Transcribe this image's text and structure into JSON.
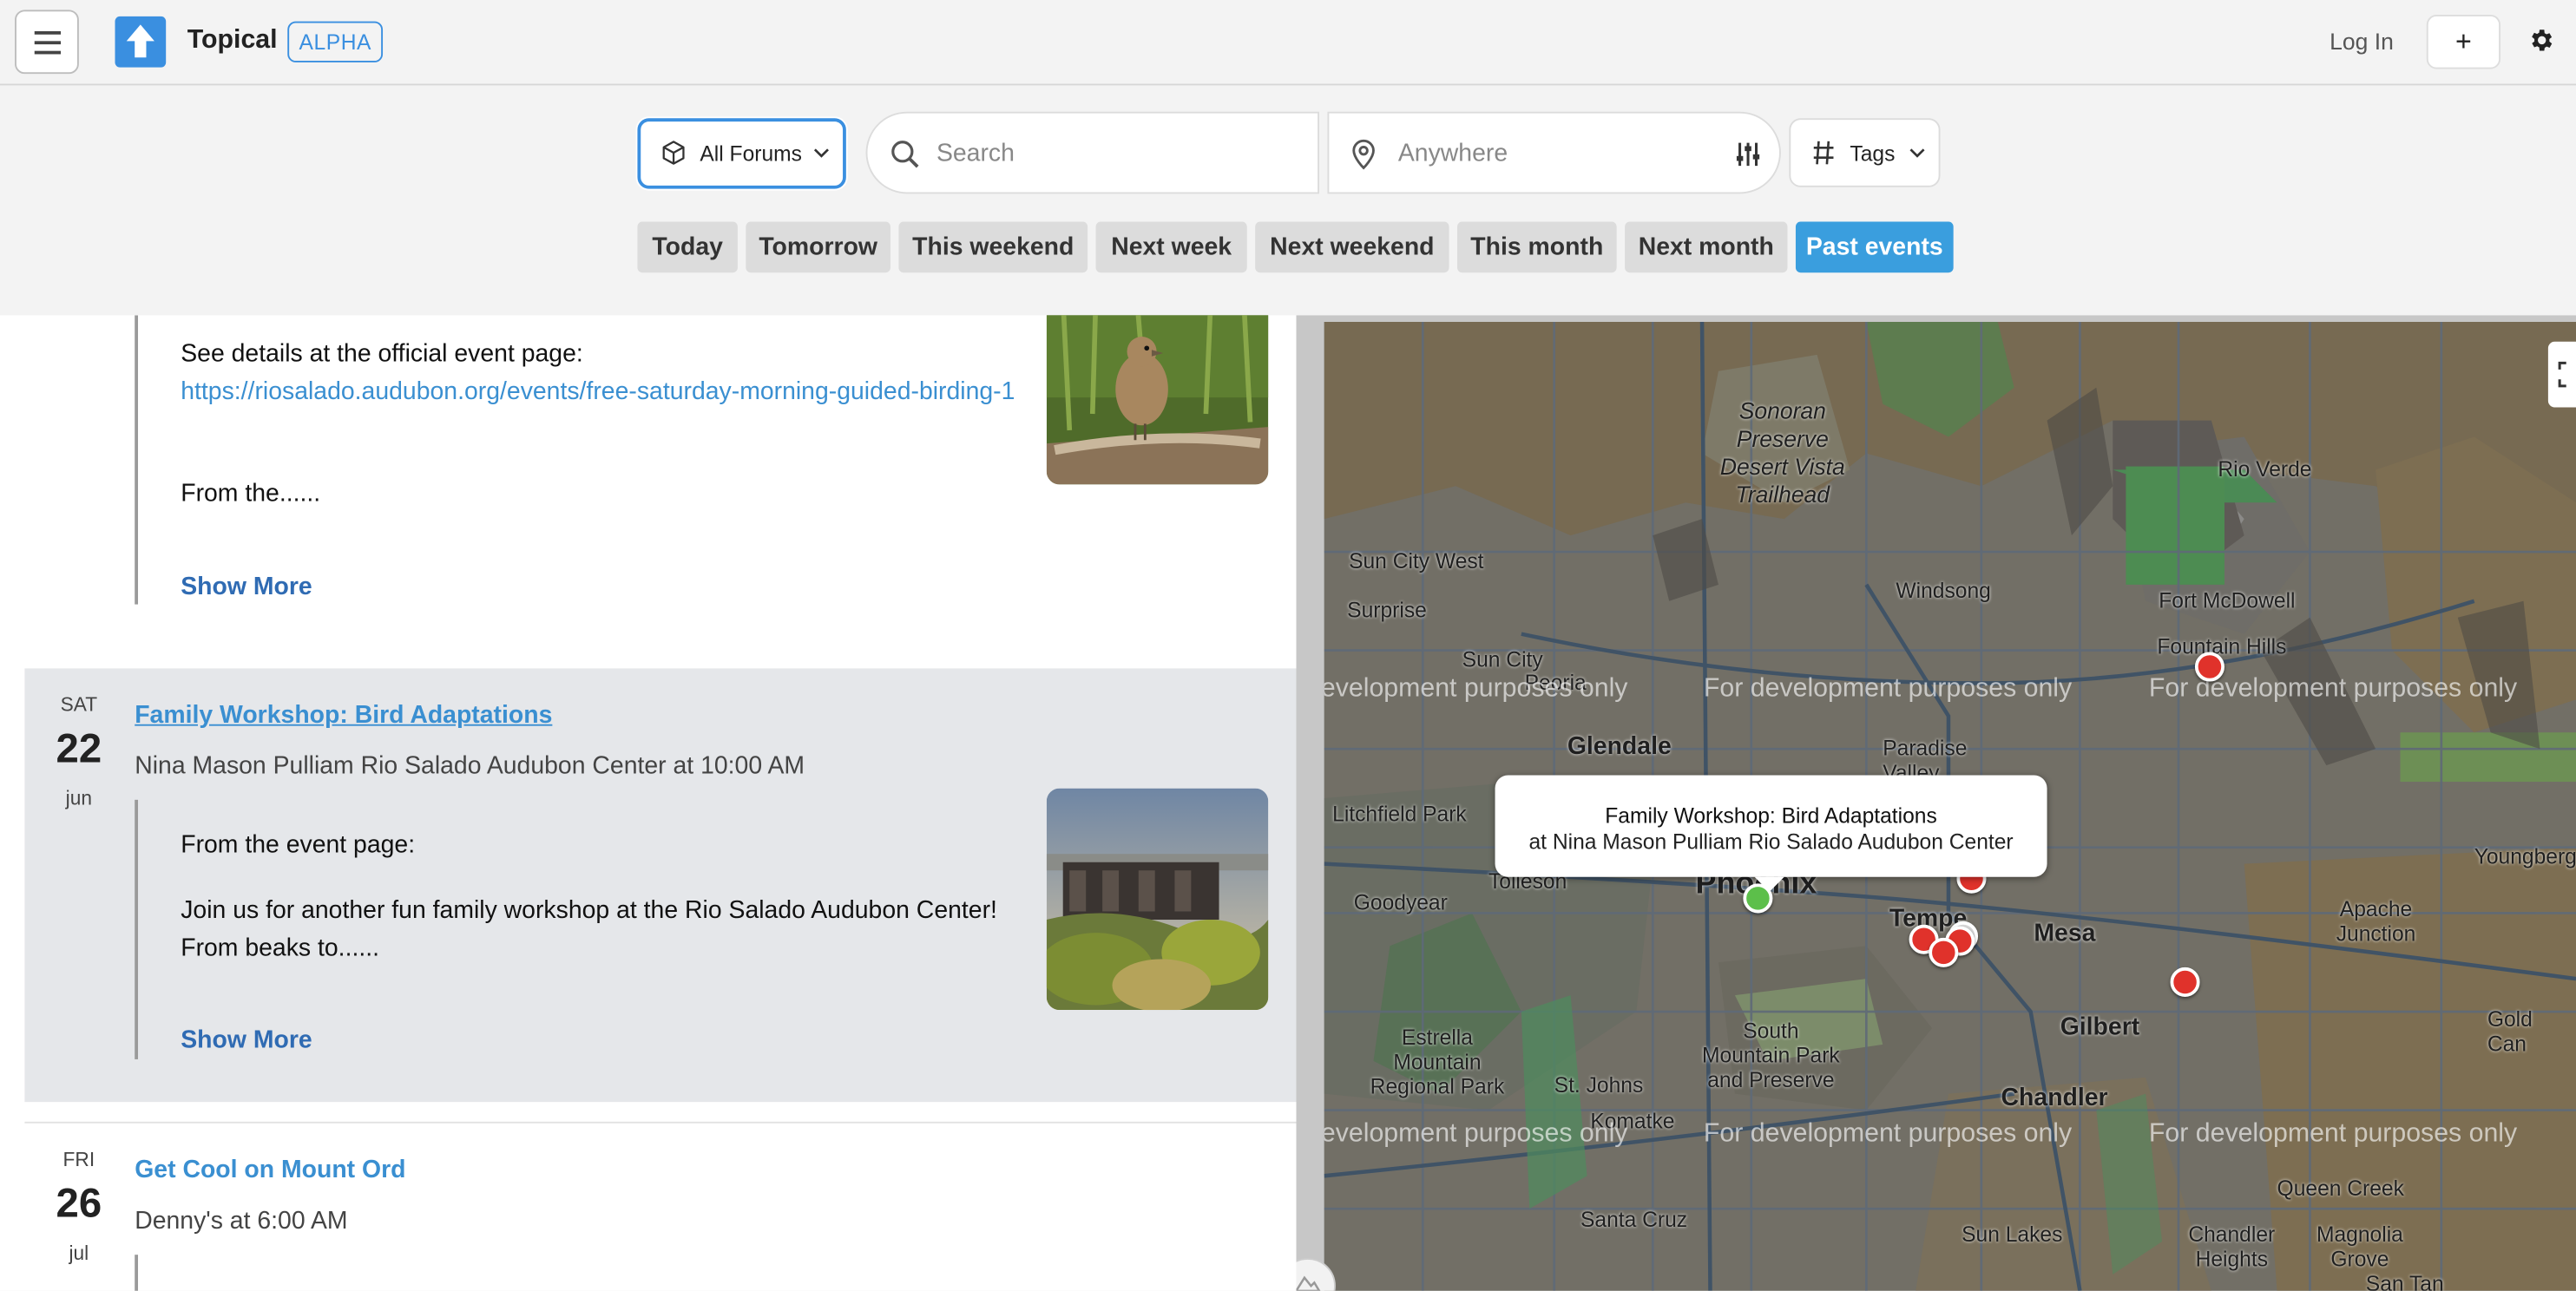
{
  "header": {
    "brand": "Topical",
    "badge": "ALPHA",
    "login_label": "Log In",
    "plus_label": "+"
  },
  "filters": {
    "forum_label": "All Forums",
    "search_placeholder": "Search",
    "location_placeholder": "Anywhere",
    "tags_label": "Tags",
    "chips": [
      "Today",
      "Tomorrow",
      "This weekend",
      "Next week",
      "Next weekend",
      "This month",
      "Next month",
      "Past events"
    ],
    "active_chip": "Past events"
  },
  "events": {
    "first": {
      "line1": "See details at the official event page:",
      "url": "https://riosalado.audubon.org/events/free-saturday-morning-guided-birding-1",
      "excerpt": "From the......",
      "show_more": "Show More"
    },
    "second": {
      "dow": "SAT",
      "day": "22",
      "month": "jun",
      "title": "Family Workshop: Bird Adaptations",
      "place": "Nina Mason Pulliam Rio Salado Audubon Center at 10:00 AM",
      "line1": "From the event page:",
      "excerpt": "Join us for another fun family workshop at the Rio Salado Audubon Center! From beaks to......",
      "show_more": "Show More"
    },
    "third": {
      "dow": "FRI",
      "day": "26",
      "month": "jul",
      "title": "Get Cool on Mount Ord",
      "place": "Denny's at 6:00 AM"
    }
  },
  "map": {
    "watermark": "For development purposes only",
    "watermark_partial": "evelopment purposes only",
    "popup_title": "Family Workshop: Bird Adaptations",
    "popup_sub": "at Nina Mason Pulliam Rio Salado Audubon Center",
    "labels": {
      "sonoran": "Sonoran",
      "preserve": "Preserve",
      "desert_vista": "Desert Vista",
      "trailhead": "Trailhead",
      "rio_verde": "Rio Verde",
      "sun_city_west": "Sun City West",
      "windsong": "Windsong",
      "fort_mcdowell": "Fort McDowell",
      "surprise": "Surprise",
      "fountain_hills": "Fountain Hills",
      "sun_city": "Sun City",
      "peoria": "Peoria",
      "glendale": "Glendale",
      "paradise_valley": "Paradise\nValley",
      "litchfield_park": "Litchfield Park",
      "tolleson": "Tolleson",
      "phoenix": "Phoenix",
      "goodyear": "Goodyear",
      "tempe": "Tempe",
      "mesa": "Mesa",
      "youngberg": "Youngberg",
      "apache_junction": "Apache\nJunction",
      "gilbert": "Gilbert",
      "gold_canyon": "Gold Can",
      "estrella_mountain": "Estrella\nMountain\nRegional Park",
      "south_mountain": "South\nMountain Park\nand Preserve",
      "st_johns": "St. Johns",
      "komatke": "Komatke",
      "chandler": "Chandler",
      "queen_creek": "Queen Creek",
      "santa_cruz": "Santa Cruz",
      "sun_lakes": "Sun Lakes",
      "chandler_heights": "Chandler\nHeights",
      "magnolia_grove": "Magnolia\nGrove",
      "san_tan": "San Tan"
    }
  },
  "colors": {
    "accent": "#3a8fe0",
    "chip_active": "#3a9ede",
    "pin_red": "#e0322b",
    "pin_green": "#5cbf4a"
  }
}
